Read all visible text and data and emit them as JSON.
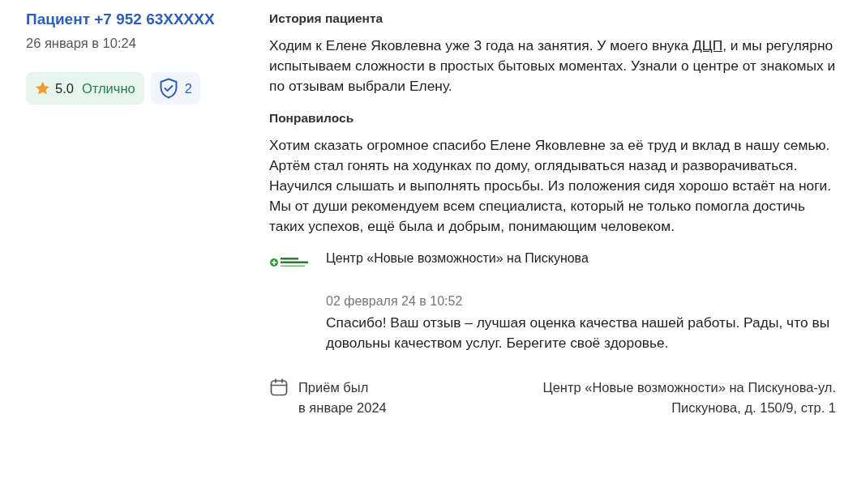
{
  "reviewer": {
    "name": "Пациент +7 952 63XXXXX",
    "date": "26 января в 10:24"
  },
  "rating": {
    "score": "5.0",
    "verdict": "Отлично"
  },
  "verified": {
    "count": "2"
  },
  "sections": [
    {
      "heading": "История пациента",
      "parts": [
        {
          "kind": "plain",
          "text": "Ходим к Елене Яковлевна уже 3 года на занятия. У моего внука "
        },
        {
          "kind": "abbr",
          "text": "ДЦП"
        },
        {
          "kind": "plain",
          "text": ", и мы регулярно испытываем сложности в простых бытовых моментах. Узнали о центре от знакомых и по отзывам выбрали Елену."
        }
      ]
    },
    {
      "heading": "Понравилось",
      "parts": [
        {
          "kind": "plain",
          "text": "Хотим сказать огромное спасибо Елене Яковлевне за её труд и вклад в нашу семью. Артём стал гонять на ходунках по дому, оглядываться назад и разворачиваться. Научился слышать и выполнять просьбы. Из положения сидя хорошо встаёт на ноги. Мы от души рекомендуем всем специалиста, который не только помогла достичь таких успехов, ещё была и добрым, понимающим человеком."
        }
      ]
    }
  ],
  "reply": {
    "author": "Центр «Новые возможности» на Пискунова",
    "date": "02 февраля 24 в 10:52",
    "text": "Спасибо! Ваш отзыв – лучшая оценка качества нашей работы. Рады, что вы довольны качеством услуг. Берегите своё здоровье."
  },
  "visit": {
    "lines": [
      "Приём был",
      "в январе 2024"
    ]
  },
  "clinic_address": {
    "lines": [
      "Центр «Новые возможности» на Пискунова-ул.",
      "Пискунова, д. 150/9, стр. 1"
    ]
  }
}
